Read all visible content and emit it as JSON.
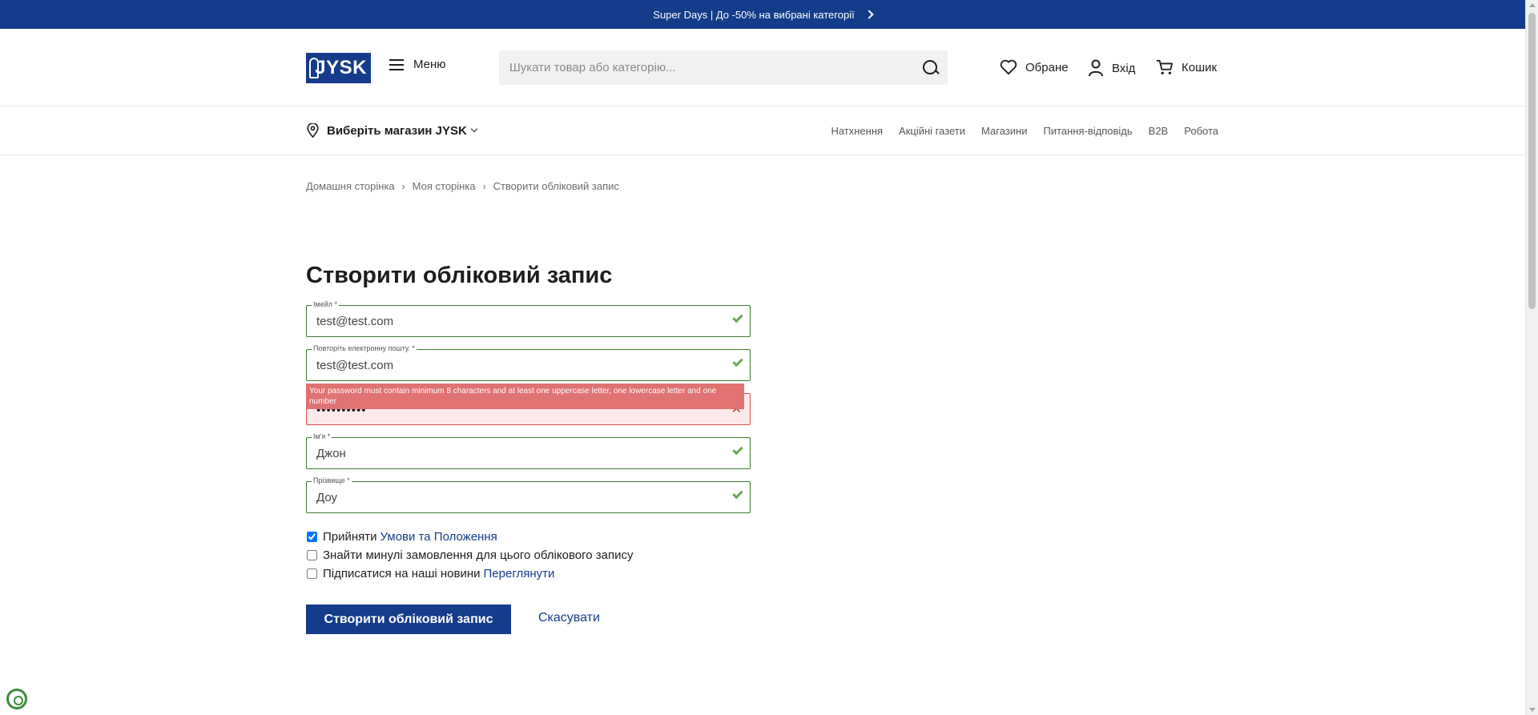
{
  "promo": {
    "text": "Super Days | До -50% на вибрані категорії"
  },
  "header": {
    "logo_text": "JYSK",
    "menu_label": "Меню",
    "search_placeholder": "Шукати товар або категорію...",
    "favorites_label": "Обране",
    "login_label": "Вхід",
    "cart_label": "Кошик"
  },
  "subnav": {
    "store_select_label": "Виберіть магазин JYSK",
    "links": [
      "Натхнення",
      "Акційні газети",
      "Магазини",
      "Питання-відповідь",
      "B2B",
      "Робота"
    ]
  },
  "breadcrumb": [
    "Домашня сторінка",
    "Моя сторінка",
    "Створити обліковий запис"
  ],
  "page_title": "Створити обліковий запис",
  "form": {
    "email": {
      "label": "Імейл *",
      "value": "test@test.com"
    },
    "email_repeat": {
      "label": "Повторіть електронну пошту. *",
      "value": "test@test.com"
    },
    "password": {
      "value": "••••••••••",
      "error": "Your password must contain minimum 8 characters and at least one uppercase letter, one lowercase letter and one number"
    },
    "first_name": {
      "label": "Ім'я *",
      "value": "Джон"
    },
    "last_name": {
      "label": "Прізвище *",
      "value": "Доу"
    }
  },
  "checkboxes": [
    {
      "label": "Прийняти",
      "link": "Умови та Положення",
      "checked": true
    },
    {
      "label": "Знайти минулі замовлення для цього облікового запису",
      "link": "",
      "checked": false
    },
    {
      "label": "Підписатися на наші новини",
      "link": "Переглянути",
      "checked": false
    }
  ],
  "actions": {
    "submit_label": "Створити обліковий запис",
    "cancel_label": "Скасувати"
  },
  "colors": {
    "brand": "#143c8a",
    "valid": "#6aa84f",
    "error": "#e07272"
  }
}
